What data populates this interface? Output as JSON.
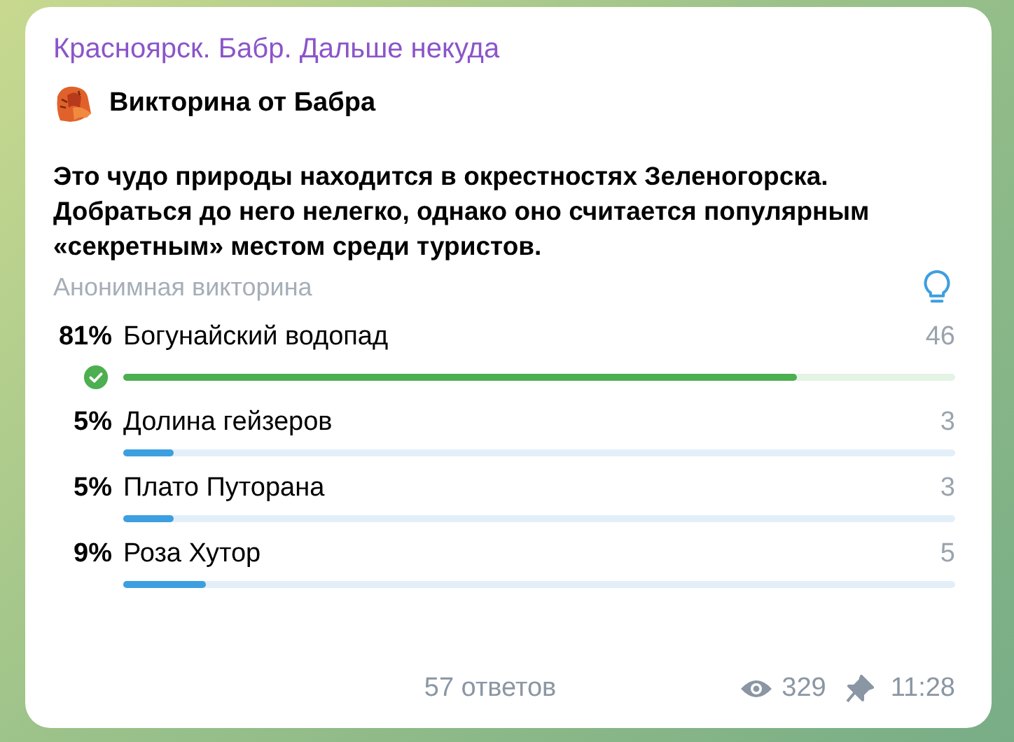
{
  "channel_name": "Красноярск. Бабр. Дальше некуда",
  "poll_title": "Викторина от Бабра",
  "question": "Это чудо природы находится в окрестностях Зеленогорска. Добраться до него нелегко, однако оно считается популярным «секретным» местом среди туристов.",
  "poll_type": "Анонимная викторина",
  "options": [
    {
      "percent": "81%",
      "label": "Богунайский водопад",
      "votes": "46",
      "level": 0.81,
      "correct": true
    },
    {
      "percent": "5%",
      "label": "Долина гейзеров",
      "votes": "3",
      "level": 0.06,
      "correct": false
    },
    {
      "percent": "5%",
      "label": "Плато Путорана",
      "votes": "3",
      "level": 0.06,
      "correct": false
    },
    {
      "percent": "9%",
      "label": "Роза Хутор",
      "votes": "5",
      "level": 0.1,
      "correct": false
    }
  ],
  "answers_count": "57 ответов",
  "views": "329",
  "pinned": true,
  "time": "11:28"
}
